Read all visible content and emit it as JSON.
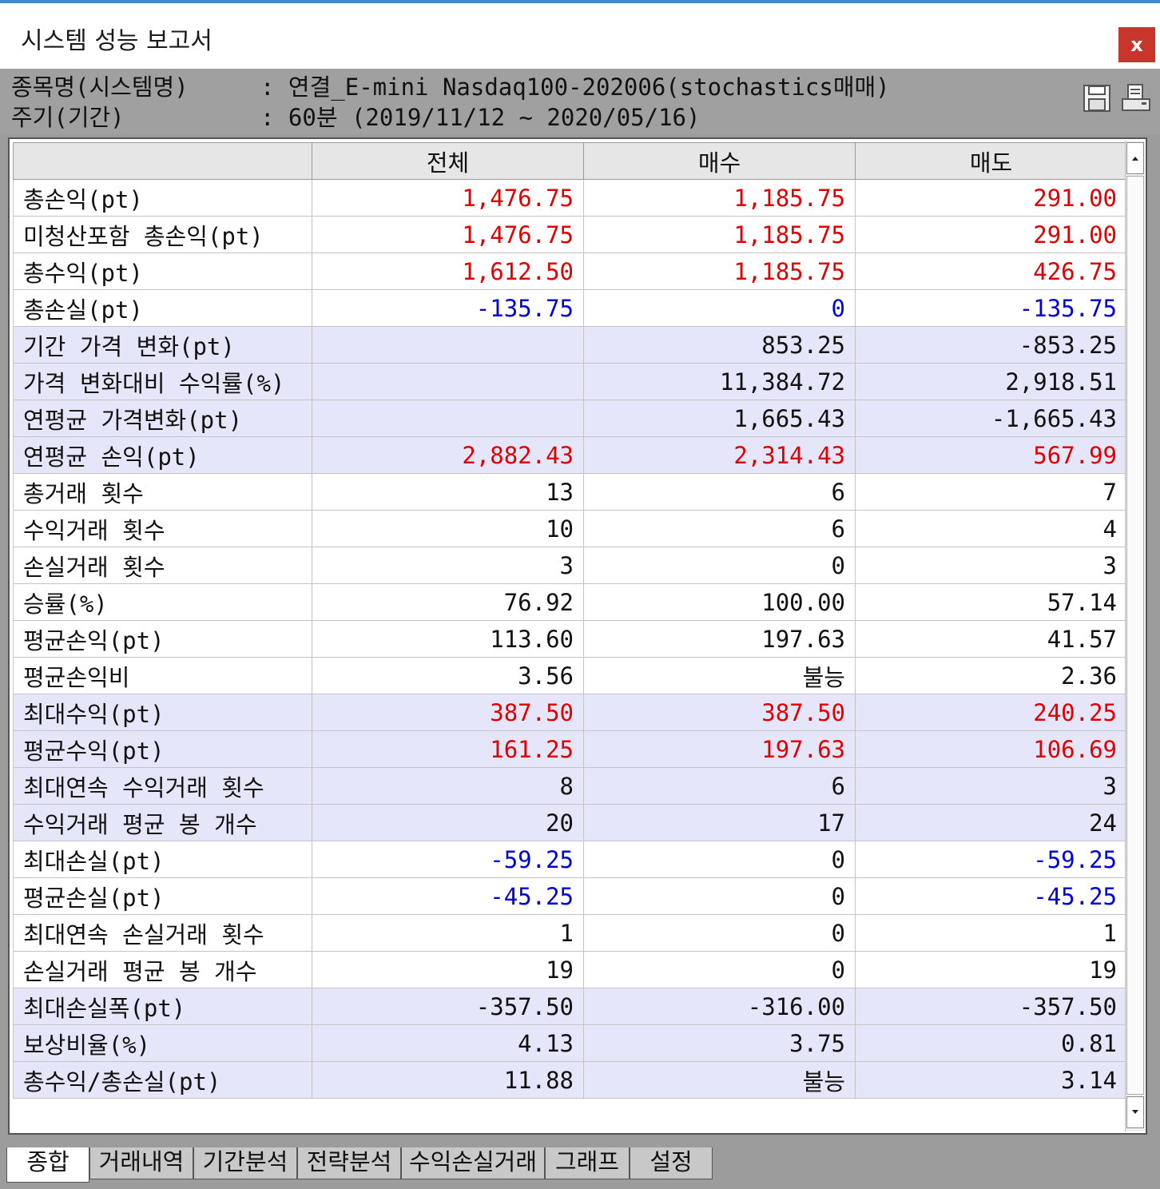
{
  "window": {
    "title": "시스템 성능 보고서",
    "close_label": "x"
  },
  "info": {
    "rows": [
      {
        "label": "종목명(시스템명)",
        "value": ": 연결_E-mini Nasdaq100-202006(stochastics매매)"
      },
      {
        "label": "주기(기간)",
        "value": ": 60분 (2019/11/12 ~ 2020/05/16)"
      }
    ],
    "icons": [
      "save-icon",
      "print-icon"
    ]
  },
  "colors": {
    "positive": "#e00000",
    "negative": "#0000d8",
    "highlight_row": "#e6e6fa"
  },
  "table": {
    "headers": [
      "",
      "전체",
      "매수",
      "매도"
    ],
    "rows": [
      {
        "label": "총손익(pt)",
        "hl": false,
        "cells": [
          {
            "v": "1,476.75",
            "c": "red"
          },
          {
            "v": "1,185.75",
            "c": "red"
          },
          {
            "v": "291.00",
            "c": "red"
          }
        ]
      },
      {
        "label": "미청산포함 총손익(pt)",
        "hl": false,
        "cells": [
          {
            "v": "1,476.75",
            "c": "red"
          },
          {
            "v": "1,185.75",
            "c": "red"
          },
          {
            "v": "291.00",
            "c": "red"
          }
        ]
      },
      {
        "label": "총수익(pt)",
        "hl": false,
        "cells": [
          {
            "v": "1,612.50",
            "c": "red"
          },
          {
            "v": "1,185.75",
            "c": "red"
          },
          {
            "v": "426.75",
            "c": "red"
          }
        ]
      },
      {
        "label": "총손실(pt)",
        "hl": false,
        "cells": [
          {
            "v": "-135.75",
            "c": "blue"
          },
          {
            "v": "0",
            "c": "blue"
          },
          {
            "v": "-135.75",
            "c": "blue"
          }
        ]
      },
      {
        "label": "기간 가격 변화(pt)",
        "hl": true,
        "cells": [
          {
            "v": "",
            "c": "black"
          },
          {
            "v": "853.25",
            "c": "black"
          },
          {
            "v": "-853.25",
            "c": "black"
          }
        ]
      },
      {
        "label": "가격 변화대비 수익률(%)",
        "hl": true,
        "cells": [
          {
            "v": "",
            "c": "black"
          },
          {
            "v": "11,384.72",
            "c": "black"
          },
          {
            "v": "2,918.51",
            "c": "black"
          }
        ]
      },
      {
        "label": "연평균 가격변화(pt)",
        "hl": true,
        "cells": [
          {
            "v": "",
            "c": "black"
          },
          {
            "v": "1,665.43",
            "c": "black"
          },
          {
            "v": "-1,665.43",
            "c": "black"
          }
        ]
      },
      {
        "label": "연평균 손익(pt)",
        "hl": true,
        "cells": [
          {
            "v": "2,882.43",
            "c": "red"
          },
          {
            "v": "2,314.43",
            "c": "red"
          },
          {
            "v": "567.99",
            "c": "red"
          }
        ]
      },
      {
        "label": "총거래 횟수",
        "hl": false,
        "cells": [
          {
            "v": "13",
            "c": "black"
          },
          {
            "v": "6",
            "c": "black"
          },
          {
            "v": "7",
            "c": "black"
          }
        ]
      },
      {
        "label": "수익거래 횟수",
        "hl": false,
        "cells": [
          {
            "v": "10",
            "c": "black"
          },
          {
            "v": "6",
            "c": "black"
          },
          {
            "v": "4",
            "c": "black"
          }
        ]
      },
      {
        "label": "손실거래 횟수",
        "hl": false,
        "cells": [
          {
            "v": "3",
            "c": "black"
          },
          {
            "v": "0",
            "c": "black"
          },
          {
            "v": "3",
            "c": "black"
          }
        ]
      },
      {
        "label": "승률(%)",
        "hl": false,
        "cells": [
          {
            "v": "76.92",
            "c": "black"
          },
          {
            "v": "100.00",
            "c": "black"
          },
          {
            "v": "57.14",
            "c": "black"
          }
        ]
      },
      {
        "label": "평균손익(pt)",
        "hl": false,
        "cells": [
          {
            "v": "113.60",
            "c": "black"
          },
          {
            "v": "197.63",
            "c": "black"
          },
          {
            "v": "41.57",
            "c": "black"
          }
        ]
      },
      {
        "label": "평균손익비",
        "hl": false,
        "cells": [
          {
            "v": "3.56",
            "c": "black"
          },
          {
            "v": "불능",
            "c": "black"
          },
          {
            "v": "2.36",
            "c": "black"
          }
        ]
      },
      {
        "label": "최대수익(pt)",
        "hl": true,
        "cells": [
          {
            "v": "387.50",
            "c": "red"
          },
          {
            "v": "387.50",
            "c": "red"
          },
          {
            "v": "240.25",
            "c": "red"
          }
        ]
      },
      {
        "label": "평균수익(pt)",
        "hl": true,
        "cells": [
          {
            "v": "161.25",
            "c": "red"
          },
          {
            "v": "197.63",
            "c": "red"
          },
          {
            "v": "106.69",
            "c": "red"
          }
        ]
      },
      {
        "label": "최대연속 수익거래 횟수",
        "hl": true,
        "cells": [
          {
            "v": "8",
            "c": "black"
          },
          {
            "v": "6",
            "c": "black"
          },
          {
            "v": "3",
            "c": "black"
          }
        ]
      },
      {
        "label": "수익거래 평균 봉 개수",
        "hl": true,
        "cells": [
          {
            "v": "20",
            "c": "black"
          },
          {
            "v": "17",
            "c": "black"
          },
          {
            "v": "24",
            "c": "black"
          }
        ]
      },
      {
        "label": "최대손실(pt)",
        "hl": false,
        "cells": [
          {
            "v": "-59.25",
            "c": "blue"
          },
          {
            "v": "0",
            "c": "black"
          },
          {
            "v": "-59.25",
            "c": "blue"
          }
        ]
      },
      {
        "label": "평균손실(pt)",
        "hl": false,
        "cells": [
          {
            "v": "-45.25",
            "c": "blue"
          },
          {
            "v": "0",
            "c": "black"
          },
          {
            "v": "-45.25",
            "c": "blue"
          }
        ]
      },
      {
        "label": "최대연속 손실거래 횟수",
        "hl": false,
        "cells": [
          {
            "v": "1",
            "c": "black"
          },
          {
            "v": "0",
            "c": "black"
          },
          {
            "v": "1",
            "c": "black"
          }
        ]
      },
      {
        "label": "손실거래 평균 봉 개수",
        "hl": false,
        "cells": [
          {
            "v": "19",
            "c": "black"
          },
          {
            "v": "0",
            "c": "black"
          },
          {
            "v": "19",
            "c": "black"
          }
        ]
      },
      {
        "label": "최대손실폭(pt)",
        "hl": true,
        "cells": [
          {
            "v": "-357.50",
            "c": "black"
          },
          {
            "v": "-316.00",
            "c": "black"
          },
          {
            "v": "-357.50",
            "c": "black"
          }
        ]
      },
      {
        "label": "보상비율(%)",
        "hl": true,
        "cells": [
          {
            "v": "4.13",
            "c": "black"
          },
          {
            "v": "3.75",
            "c": "black"
          },
          {
            "v": "0.81",
            "c": "black"
          }
        ]
      },
      {
        "label": "총수익/총손실(pt)",
        "hl": true,
        "cells": [
          {
            "v": "11.88",
            "c": "black"
          },
          {
            "v": "불능",
            "c": "black"
          },
          {
            "v": "3.14",
            "c": "black"
          }
        ]
      }
    ]
  },
  "tabs": [
    {
      "label": "종합",
      "active": true
    },
    {
      "label": "거래내역",
      "active": false
    },
    {
      "label": "기간분석",
      "active": false
    },
    {
      "label": "전략분석",
      "active": false
    },
    {
      "label": "수익손실거래",
      "active": false
    },
    {
      "label": "그래프",
      "active": false
    },
    {
      "label": "설정",
      "active": false
    }
  ]
}
